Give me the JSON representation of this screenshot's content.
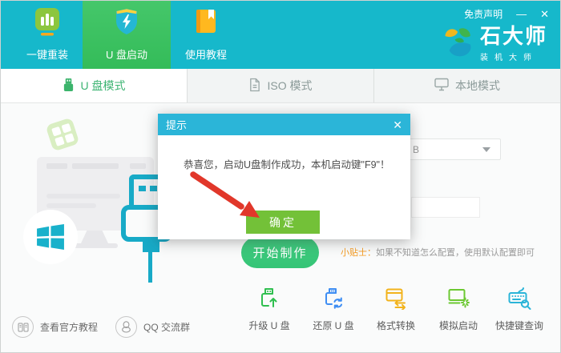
{
  "header": {
    "disclaimer": "免责声明",
    "minimize": "—",
    "close": "✕",
    "brand": {
      "name": "石大师",
      "subtitle": "装机大师"
    },
    "tabs": [
      {
        "label": "一键重装"
      },
      {
        "label": "U 盘启动"
      },
      {
        "label": "使用教程"
      }
    ]
  },
  "mode_tabs": [
    {
      "label": "U 盘模式"
    },
    {
      "label": "ISO 模式"
    },
    {
      "label": "本地模式"
    }
  ],
  "dialog": {
    "title": "提示",
    "close": "✕",
    "message": "恭喜您，启动U盘制作成功，本机启动键\"F9\"！",
    "ok_label": "确定"
  },
  "content": {
    "start_button": "开始制作",
    "tip_label": "小贴士：",
    "tip_text": "如果不知道怎么配置，使用默认配置即可",
    "dropdown_visible_text": "B"
  },
  "footer": {
    "links": [
      {
        "label": "查看官方教程"
      },
      {
        "label": "QQ 交流群"
      }
    ],
    "tools": [
      {
        "label": "升级 U 盘"
      },
      {
        "label": "还原 U 盘"
      },
      {
        "label": "格式转换"
      },
      {
        "label": "模拟启动"
      },
      {
        "label": "快捷键查询"
      }
    ]
  },
  "colors": {
    "header_teal": "#16b8cb",
    "active_tab_green": "#3cc263",
    "dialog_titlebar_blue": "#2bb5d8",
    "ok_button_green": "#73c138",
    "start_button_green": "#3bca7c",
    "tip_orange": "#f59b22",
    "usb_outline_teal": "#18aac7",
    "arrow_red": "#e1372a"
  }
}
